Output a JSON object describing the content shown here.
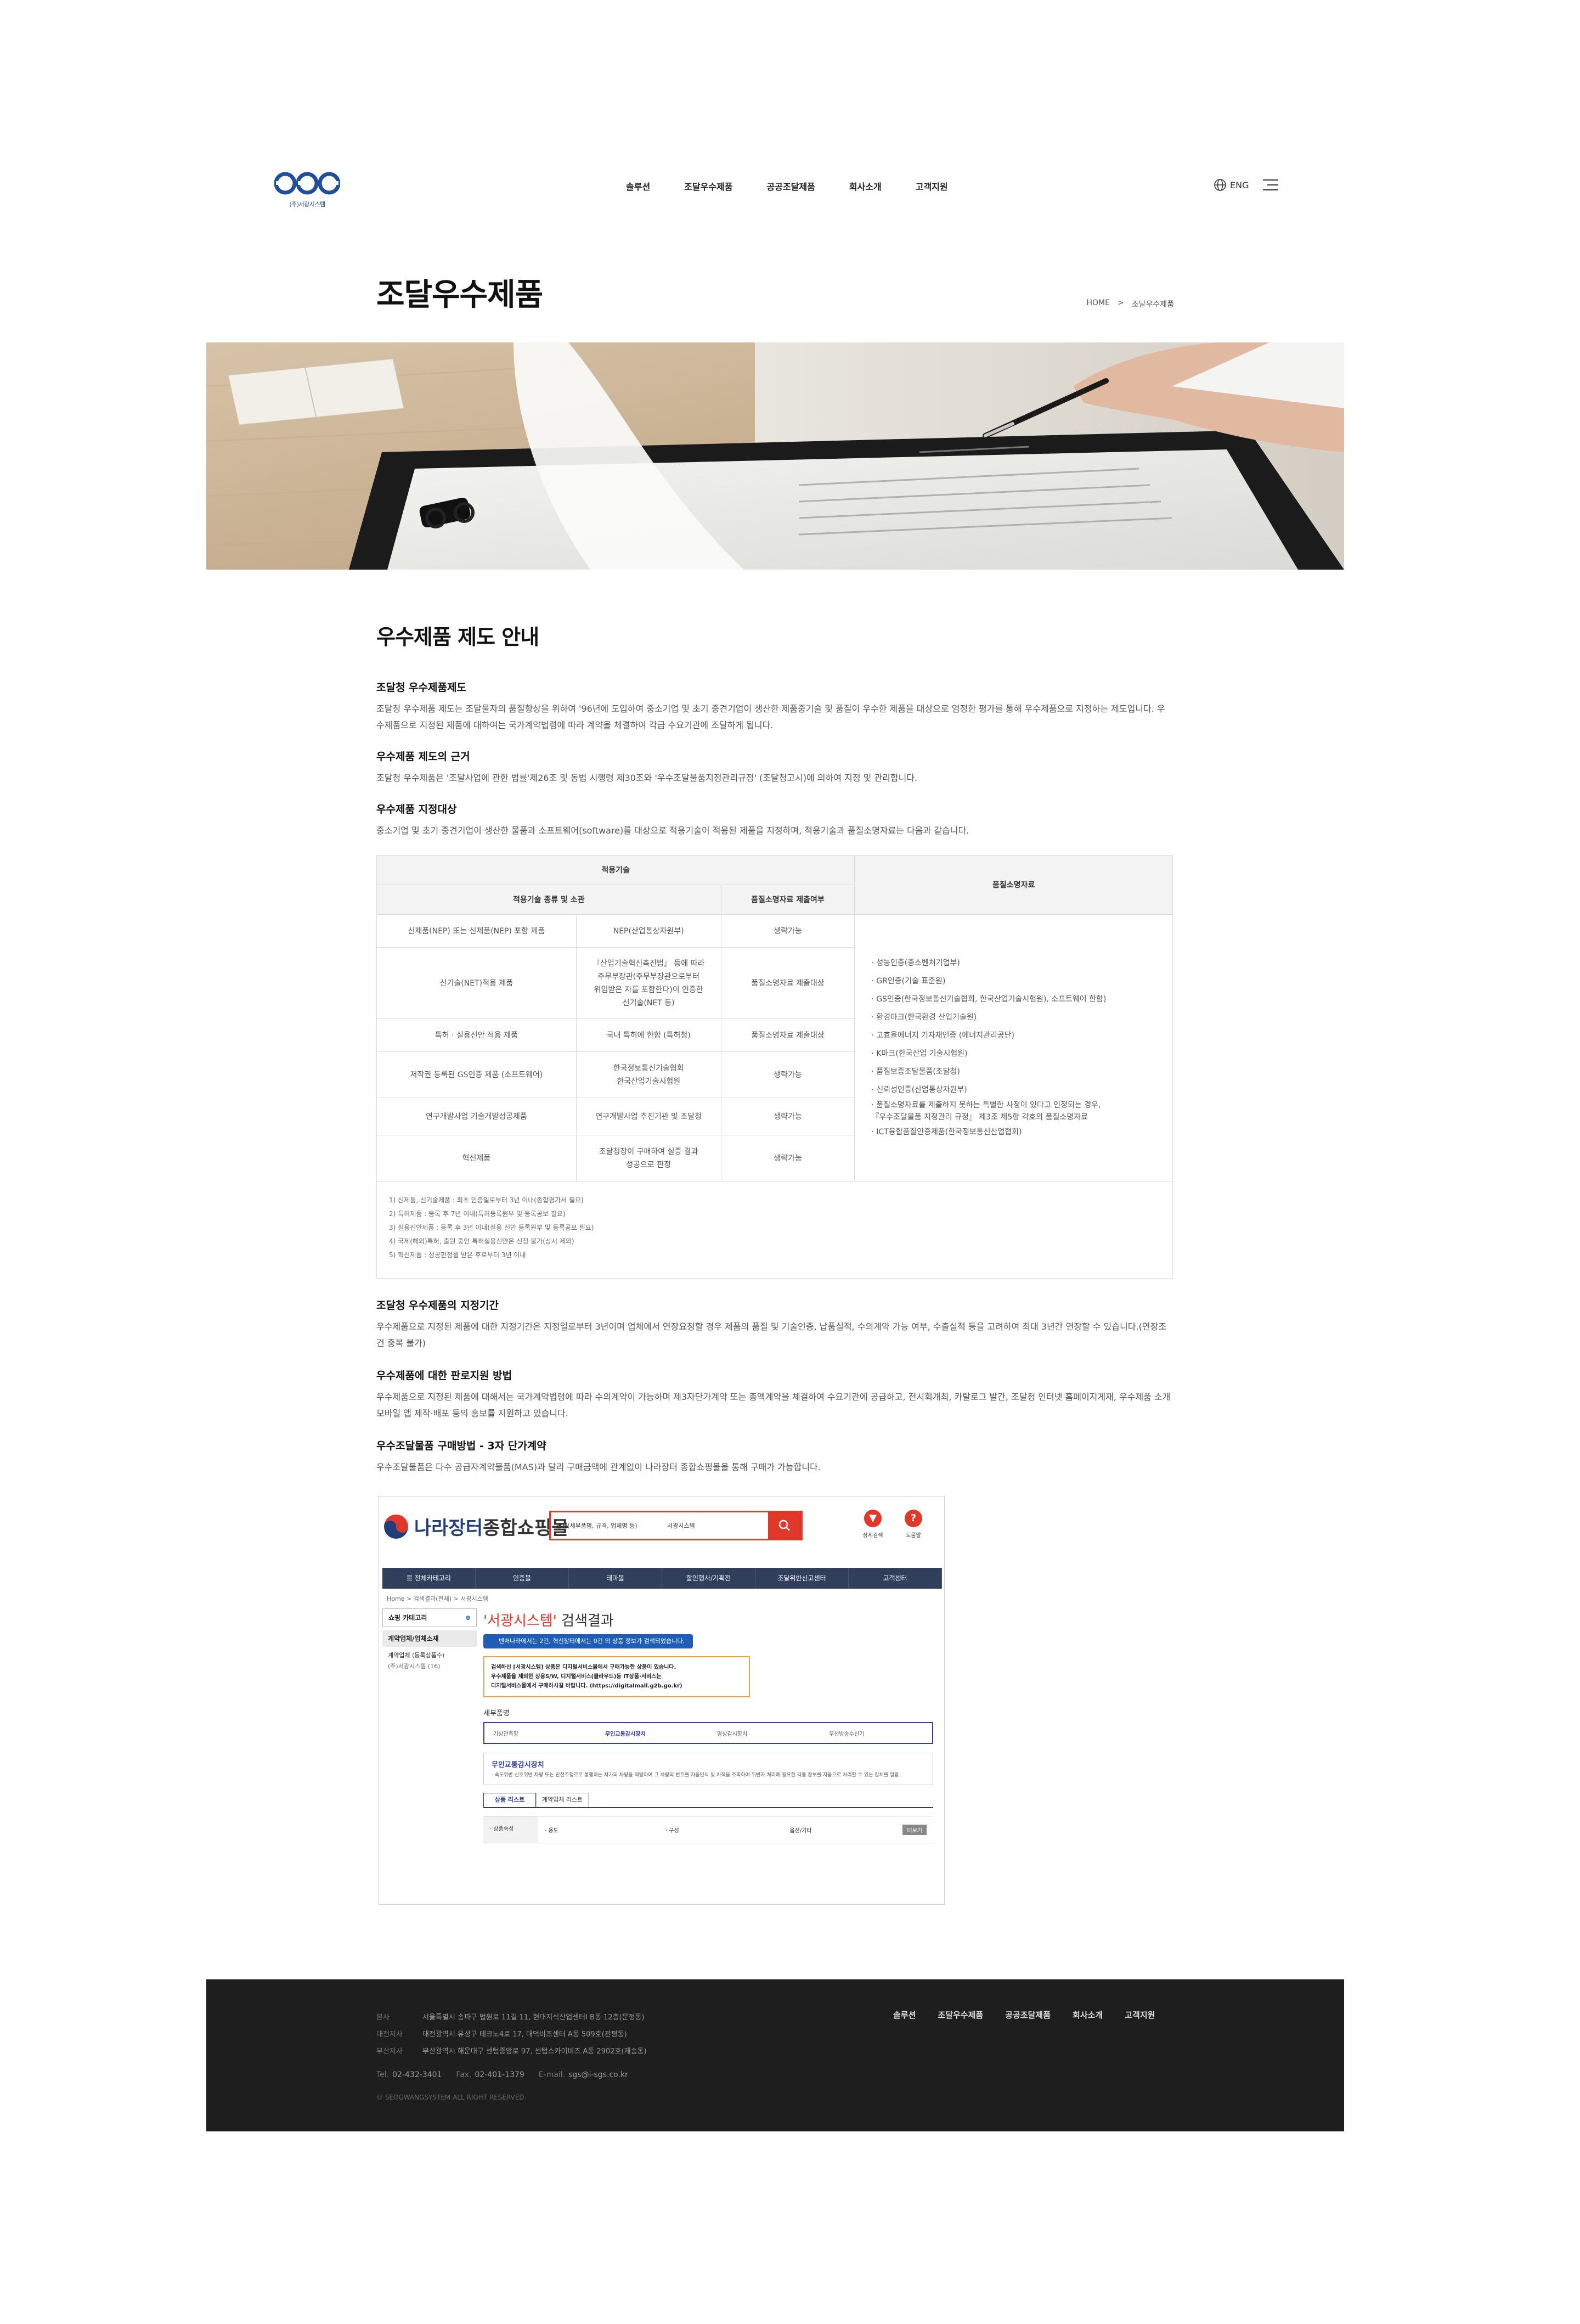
{
  "header": {
    "logo_subtext": "(주)서광시스템",
    "nav": [
      "솔루션",
      "조달우수제품",
      "공공조달제품",
      "회사소개",
      "고객지원"
    ],
    "lang": "ENG"
  },
  "page": {
    "title": "조달우수제품",
    "breadcrumb": [
      "HOME",
      ">",
      "조달우수제품"
    ]
  },
  "section_title": "우수제품 제도 안내",
  "blocks": {
    "intro": {
      "title": "조달청 우수제품제도",
      "text": "조달청 우수제품 제도는 조달물자의 품질향상을 위하여 '96년에 도입하여 중소기업 및 초기 중견기업이 생산한 제품중기술 및 품질이 우수한 제품을 대상으로 엄정한 평가를 통해 우수제품으로 지정하는 제도입니다. 우수제품으로 지정된 제품에 대하여는 국가계약법령에 따라 계약을 체결하여 각급 수요기관에 조달하게 됩니다."
    },
    "basis": {
      "title": "우수제품 제도의 근거",
      "text": "조달청 우수제품은 '조달사업에 관한 법률'제26조 및 동법 시행령 제30조와 '우수조달물품지정관리규정' (조달청고시)에 의하여 지정 및 관리합니다."
    },
    "target": {
      "title": "우수제품 지정대상",
      "text": "중소기업 및 초기 중견기업이 생산한 물품과 소프트웨어(software)를 대상으로 적용기술이 적용된 제품을 지정하며, 적용기술과 품질소명자료는 다음과 같습니다."
    },
    "period": {
      "title": "조달청 우수제품의 지정기간",
      "text": "우수제품으로 지정된 제품에 대한 지정기간은 지정일로부터 3년이며 업체에서 연장요청할 경우 제품의 품질 및 기술인증, 납품실적, 수의계약 가능 여부, 수출실적 등을 고려하여 최대 3년간 연장할 수 있습니다.(연장조건 중복 불가)"
    },
    "support": {
      "title": "우수제품에 대한 판로지원 방법",
      "text": "우수제품으로 지정된 제품에 대해서는 국가계약법령에 따라 수의계약이 가능하며 제3자단가계약 또는 총액계약을 체결하여 수요기관에 공급하고, 전시회개최, 카탈로그 발간, 조달청 인터넷 홈페이지게재, 우수제품 소개 모바일 앱 제작·배포 등의 홍보를 지원하고 있습니다."
    },
    "purchase": {
      "title": "우수조달물품 구매방법 - 3자 단가계약",
      "text": "우수조달물품은 다수 공급자계약물품(MAS)과 달리 구매금액에 관계없이 나라장터 종합쇼핑몰을 통해 구매가 가능합니다."
    }
  },
  "table": {
    "head_tech": "적용기술",
    "head_kind": "적용기술 종류 및 소관",
    "head_submit": "품질소명자료 제출여부",
    "head_quality": "품질소명자료",
    "rows": [
      {
        "kind": "신제품(NEP) 또는 신제품(NEP) 포함 제품",
        "org": "NEP(산업통상자원부)",
        "submit": "생략가능"
      },
      {
        "kind": "신기술(NET)적용 제품",
        "org": "『산업기술혁신촉진법』 등에 따라\n주무부장관(주무부장관으로부터\n위임받은 자를 포함한다)이 인증한\n신기술(NET 등)",
        "submit": "품질소명자료 제출대상"
      },
      {
        "kind": "특허 · 실용신안 적용 제품",
        "org": "국내 특허에 한함 (특허청)",
        "submit": "품질소명자료 제출대상"
      },
      {
        "kind": "저작권 등록된 GS인증 제품 (소프트웨어)",
        "org": "한국정보통신기술협회\n한국산업기술시험원",
        "submit": "생략가능"
      },
      {
        "kind": "연구개발사업 기술개발성공제품",
        "org": "연구개발사업 추진기관 및 조달청",
        "submit": "생략가능"
      },
      {
        "kind": "혁신제품",
        "org": "조달청장이 구매하여 실증 결과\n성공으로 판정",
        "submit": "생략가능"
      }
    ],
    "quality_items": [
      "· 성능인증(중소벤처기업부)",
      "· GR인증(기술 표준원)",
      "· GS인증(한국정보통신기술협회, 한국산업기술시험원), 소프트웨어 한함)",
      "· 환경마크(한국환경 산업기술원)",
      "· 고효율에너지 기자재인증 (에너지관리공단)",
      "· K마크(한국산업 기술시험원)",
      "· 품질보증조달물품(조달청)",
      "· 신뢰성인증(산업통상자원부)",
      "· 품질소명자료를 제출하지 못하는 특별한 사정이 있다고 인정되는 경우,\n  『우수조달물품 지정관리 규정』 제3조 제5항 각호의 품질소명자료",
      "· ICT융합품질인증제품(한국정보통신산업협회)"
    ]
  },
  "notes": [
    "1) 신제품, 신기술제품 : 최초 인증일로부터 3년 이내(종합평가서 필요)",
    "2) 특허제품 : 등록 후 7년 이내(특허등록원부 및 등록공보 필요)",
    "3) 실용신안제품 : 등록 후 3년 이내(실용 신안 등록원부 및 등록공보 필요)",
    "4) 국제(해외)특허, 출원 중인 특허실용신안은 신청 불가(상시 제외)",
    "5) 혁신제품 : 성공판정을 받은 후로부터 3년 이내"
  ],
  "mall": {
    "brand_a": "나라장터",
    "brand_b": "종합쇼핑몰",
    "search_select": "전체(세부품명, 규격, 업체명 등)",
    "search_value": "서광시스템",
    "quick1": "상세검색",
    "quick2": "도움말",
    "nav": [
      "☰ 전체카테고리",
      "인증몰",
      "테마몰",
      "할인행사/기획전",
      "조달위반신고센터",
      "고객센터"
    ],
    "crumb": "Home > 검색결과(전체) > 서광시스템",
    "side_title": "쇼핑 카테고리",
    "side_tab": "계약업체/업체소재",
    "side_item": "계약업체 (등록상품수)",
    "side_sub": "(주)서광시스템 (16)",
    "result_title_q": "'서광시스템'",
    "result_title_rest": " 검색결과",
    "infobar": "벤처나라에서는 2건, 혁신장터에서는 0건 의 상품 정보가 검색되었습니다.",
    "alert": "검색하신 [서광시스템] 상품은 디지털서비스몰에서 구매가능한 상품이 있습니다.\n우수제품을 제외한 상용S/W, 디지털서비스(클라우드)등 IT상품·서비스는\n디지털서비스몰에서 구매하시길 바랍니다. (https://digitalmall.g2b.go.kr)",
    "sub_label": "세부품명",
    "sub_tabs": [
      "기상관측장",
      "무인교통감시장치",
      "영상감시장치",
      "무선방송수신기"
    ],
    "desc_title": "무인교통감시장치",
    "desc_text": "· 속도위반 신호위반 차량 또는 안전주행로로 통행하는 차가의 차량을 적발하여 그 차량의 번호를 자동인식 및 차적을 조회하여 위반자 처리에 필요한 각종 정보를 자동으로 처리할 수 있는 장치를 말함.",
    "ptabs": [
      "상품 리스트",
      "계약업체 리스트"
    ],
    "attr_key": "· 상품속성",
    "attr_vals": [
      "· 용도",
      "· 구성",
      "· 옵션/기타"
    ],
    "attr_btn": "더보기"
  },
  "footer": {
    "addresses": [
      {
        "k": "본사",
        "v": "서울특별시 송파구 법원로 11길 11, 현대지식산업센터Ⅰ B동 12층(문정동)"
      },
      {
        "k": "대전지사",
        "v": "대전광역시 유성구 테크노4로 17, 대덕비즈센터 A동 509호(관평동)"
      },
      {
        "k": "부산지사",
        "v": "부산광역시 해운대구 센텀중앙로 97, 센텀스카이비즈 A동 2902호(재송동)"
      }
    ],
    "tel_k": "Tel.",
    "tel": "02-432-3401",
    "fax_k": "Fax.",
    "fax": "02-401-1379",
    "email_k": "E-mail.",
    "email": "sgs@i-sgs.co.kr",
    "copy": "© SEOGWANGSYSTEM ALL RIGHT RESERVED.",
    "nav": [
      "솔루션",
      "조달우수제품",
      "공공조달제품",
      "회사소개",
      "고객지원"
    ]
  }
}
